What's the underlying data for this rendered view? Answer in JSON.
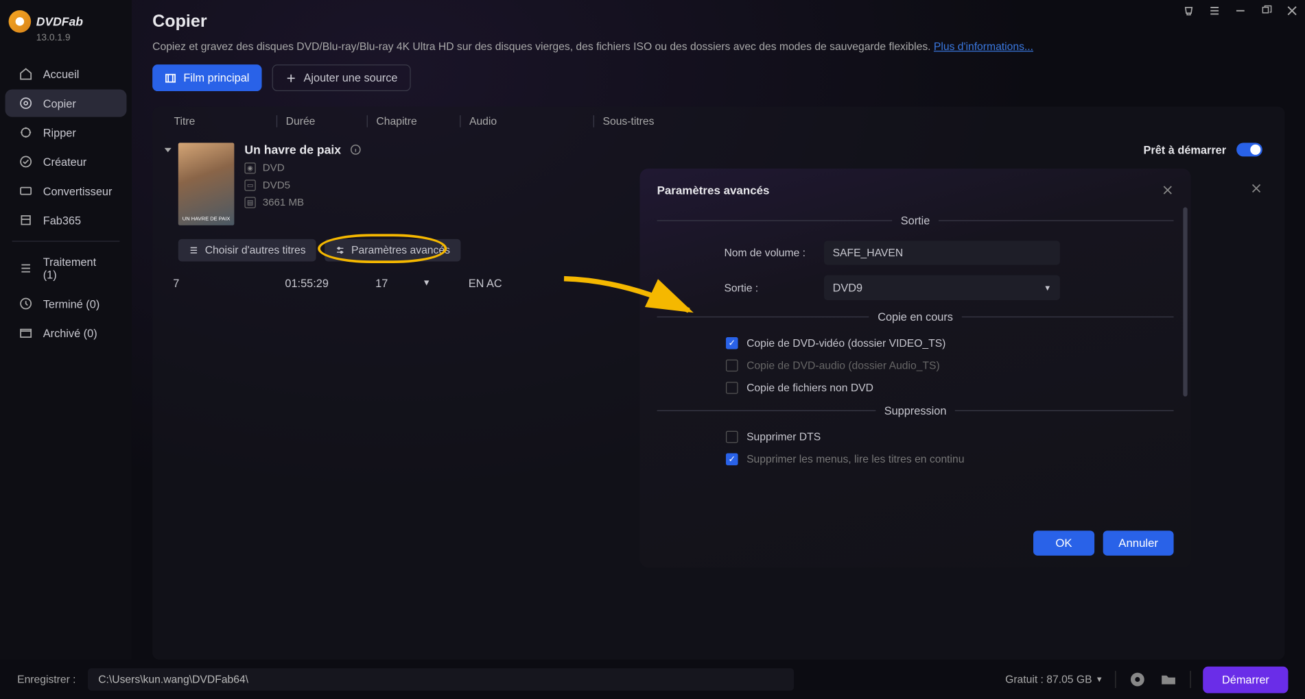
{
  "brand": {
    "name": "DVDFab",
    "version": "13.0.1.9"
  },
  "sidebar": {
    "items": [
      {
        "label": "Accueil",
        "icon": "home"
      },
      {
        "label": "Copier",
        "icon": "copy",
        "active": true
      },
      {
        "label": "Ripper",
        "icon": "ripper"
      },
      {
        "label": "Créateur",
        "icon": "creator"
      },
      {
        "label": "Convertisseur",
        "icon": "converter"
      },
      {
        "label": "Fab365",
        "icon": "fab365"
      }
    ],
    "queue": [
      {
        "label": "Traitement (1)"
      },
      {
        "label": "Terminé (0)"
      },
      {
        "label": "Archivé (0)"
      }
    ]
  },
  "page": {
    "title": "Copier",
    "desc": "Copiez et gravez des disques DVD/Blu-ray/Blu-ray 4K Ultra HD sur des disques vierges, des fichiers ISO ou des dossiers avec des modes de sauvegarde flexibles. ",
    "more_link": "Plus d'informations...",
    "main_movie_btn": "Film principal",
    "add_source_btn": "Ajouter une source"
  },
  "table": {
    "headers": {
      "title": "Titre",
      "duration": "Durée",
      "chapter": "Chapitre",
      "audio": "Audio",
      "subtitle": "Sous-titres"
    },
    "movie": {
      "title": "Un havre de paix",
      "disc_type": "DVD",
      "disc_size": "DVD5",
      "file_size": "3661 MB"
    },
    "buttons": {
      "other_titles": "Choisir d'autres titres",
      "advanced": "Paramètres avancés"
    },
    "row": {
      "num": "7",
      "duration": "01:55:29",
      "chapter": "17",
      "audio": "EN  AC"
    },
    "ready_label": "Prêt à démarrer"
  },
  "modal": {
    "title": "Paramètres avancés",
    "section_output": "Sortie",
    "volume_label": "Nom de volume :",
    "volume_value": "SAFE_HAVEN",
    "output_label": "Sortie :",
    "output_value": "DVD9",
    "section_copy": "Copie en cours",
    "copy_video": "Copie de DVD-vidéo (dossier VIDEO_TS)",
    "copy_audio": "Copie de DVD-audio (dossier Audio_TS)",
    "copy_nondvd": "Copie de fichiers non DVD",
    "section_remove": "Suppression",
    "remove_dts": "Supprimer DTS",
    "remove_menus": "Supprimer les menus, lire les titres en continu",
    "ok": "OK",
    "cancel": "Annuler"
  },
  "footer": {
    "save_label": "Enregistrer :",
    "path": "C:\\Users\\kun.wang\\DVDFab64\\",
    "free_space": "Gratuit : 87.05 GB",
    "start": "Démarrer"
  }
}
